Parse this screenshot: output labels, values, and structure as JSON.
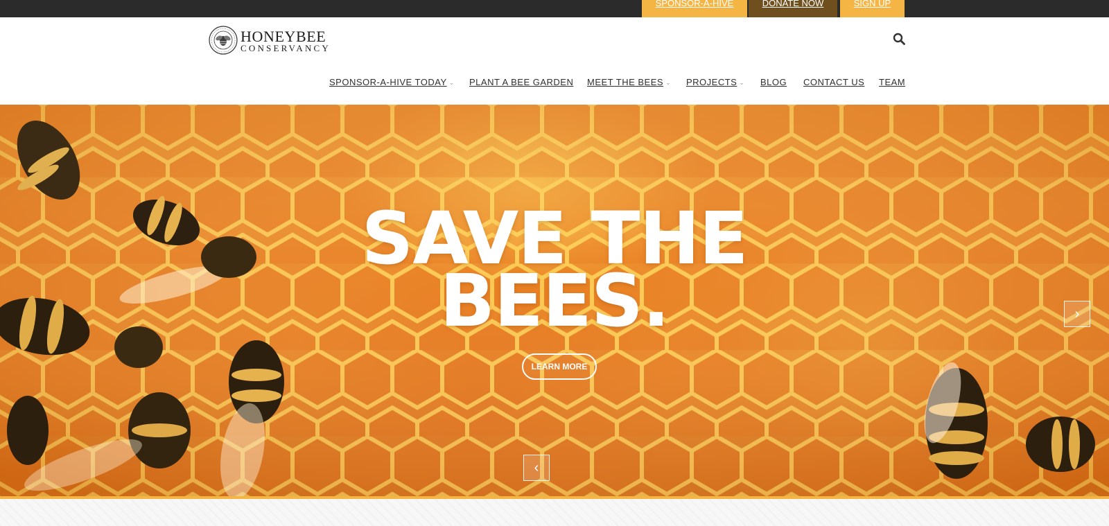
{
  "topbar": {
    "sponsor_label": "SPONSOR-A-HIVE",
    "donate_label": "DONATE NOW",
    "signup_label": "SIGN UP",
    "colors": {
      "gold": "#f5b545",
      "brown": "#6f4f1d",
      "bar": "#2b2b2b"
    }
  },
  "header": {
    "logo_line1": "HONEYBEE",
    "logo_line2": "CONSERVANCY",
    "logo_seal_text": "THE HONEYBEE CONSERVANCY",
    "search_icon": "search-icon"
  },
  "nav": {
    "items": [
      {
        "label": "SPONSOR-A-HIVE TODAY",
        "has_dropdown": true
      },
      {
        "label": "PLANT A BEE GARDEN",
        "has_dropdown": false
      },
      {
        "label": "MEET THE BEES",
        "has_dropdown": true
      },
      {
        "label": "PROJECTS",
        "has_dropdown": true
      },
      {
        "label": "BLOG",
        "has_dropdown": false
      },
      {
        "label": "CONTACT US",
        "has_dropdown": false
      },
      {
        "label": "TEAM",
        "has_dropdown": false
      }
    ],
    "dropdown_icon": "chevron-down-icon"
  },
  "hero": {
    "title_line1": "SAVE THE",
    "title_line2": "BEES.",
    "cta_label": "LEARN MORE",
    "next_icon": "chevron-right-icon",
    "prev_icon": "chevron-left-icon",
    "image": "honeycomb-with-bees-photo",
    "accent": "#f5b545"
  }
}
